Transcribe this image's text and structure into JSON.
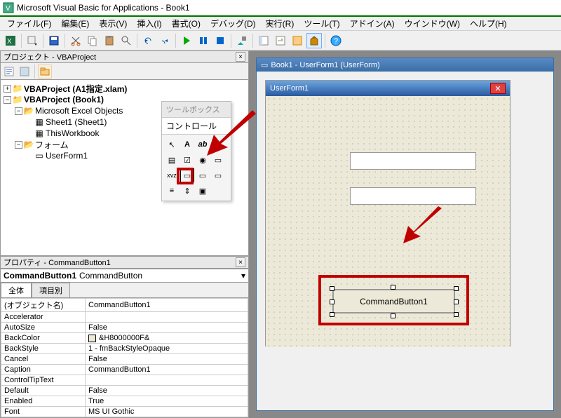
{
  "title": "Microsoft Visual Basic for Applications - Book1",
  "menus": [
    "ファイル(F)",
    "編集(E)",
    "表示(V)",
    "挿入(I)",
    "書式(O)",
    "デバッグ(D)",
    "実行(R)",
    "ツール(T)",
    "アドイン(A)",
    "ウインドウ(W)",
    "ヘルプ(H)"
  ],
  "projectPanel": {
    "title": "プロジェクト - VBAProject",
    "tree": {
      "p1": "VBAProject (A1指定.xlam)",
      "p2": "VBAProject (Book1)",
      "n1": "Microsoft Excel Objects",
      "n2": "Sheet1 (Sheet1)",
      "n3": "ThisWorkbook",
      "n4": "フォーム",
      "n5": "UserForm1"
    }
  },
  "propsPanel": {
    "title": "プロパティ - CommandButton1",
    "objName": "CommandButton1",
    "objType": "CommandButton",
    "tabs": [
      "全体",
      "項目別"
    ],
    "rows": [
      [
        "(オブジェクト名)",
        "CommandButton1"
      ],
      [
        "Accelerator",
        ""
      ],
      [
        "AutoSize",
        "False"
      ],
      [
        "BackColor",
        "&H8000000F&"
      ],
      [
        "BackStyle",
        "1 - fmBackStyleOpaque"
      ],
      [
        "Cancel",
        "False"
      ],
      [
        "Caption",
        "CommandButton1"
      ],
      [
        "ControlTipText",
        ""
      ],
      [
        "Default",
        "False"
      ],
      [
        "Enabled",
        "True"
      ],
      [
        "Font",
        "MS UI Gothic"
      ]
    ]
  },
  "mdi": {
    "title": "Book1 - UserForm1 (UserForm)"
  },
  "userform": {
    "title": "UserForm1",
    "button": "CommandButton1"
  },
  "toolbox": {
    "title": "ツールボックス",
    "tab": "コントロール"
  }
}
